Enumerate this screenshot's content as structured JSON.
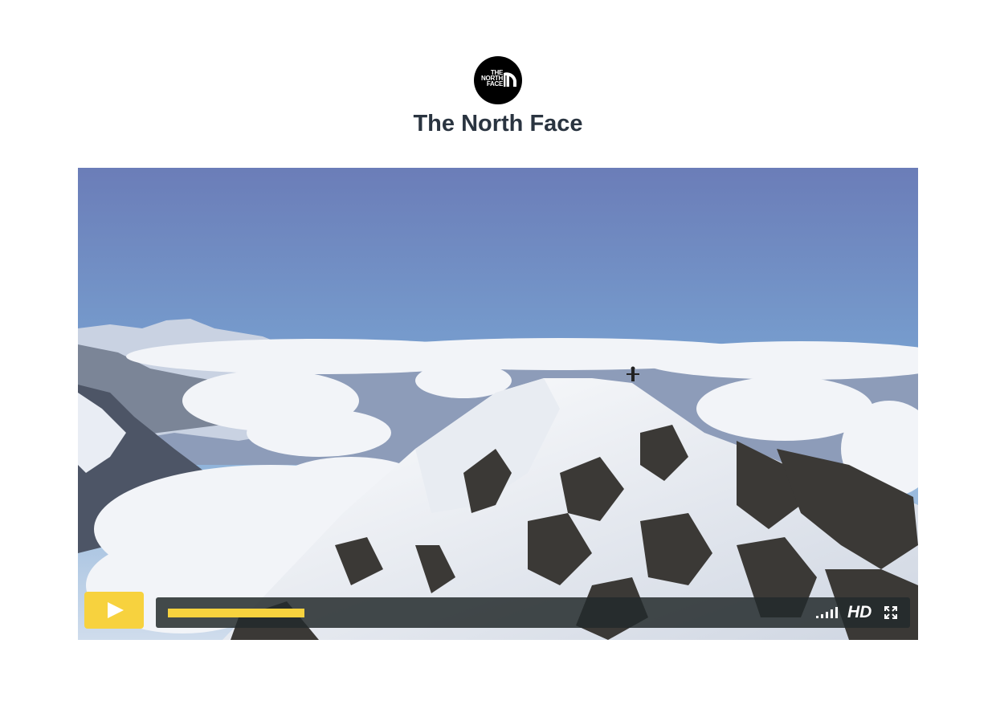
{
  "brand": {
    "logo_lines": [
      "THE",
      "NORTH",
      "FACE"
    ],
    "title": "The North Face",
    "logo_bg": "#000000"
  },
  "player": {
    "play_icon": "play-icon",
    "progress_fraction": 0.218,
    "volume_icon": "volume-bars-icon",
    "hd_label": "HD",
    "fullscreen_icon": "fullscreen-icon",
    "accent_color": "#f7d23e"
  }
}
